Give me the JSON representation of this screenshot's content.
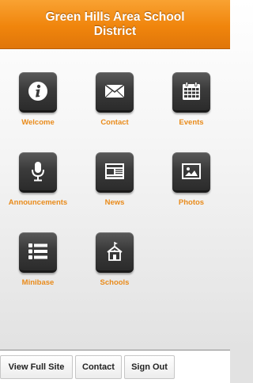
{
  "header": {
    "title": "Green Hills Area School District"
  },
  "tiles": [
    {
      "label": "Welcome",
      "icon": "info-icon"
    },
    {
      "label": "Contact",
      "icon": "envelope-icon"
    },
    {
      "label": "Events",
      "icon": "calendar-icon"
    },
    {
      "label": "Announcements",
      "icon": "microphone-icon"
    },
    {
      "label": "News",
      "icon": "newspaper-icon"
    },
    {
      "label": "Photos",
      "icon": "photo-icon"
    },
    {
      "label": "Minibase",
      "icon": "list-icon"
    },
    {
      "label": "Schools",
      "icon": "school-building-icon"
    }
  ],
  "footer": {
    "view_full_site": "View Full Site",
    "contact": "Contact",
    "sign_out": "Sign Out"
  },
  "colors": {
    "header_orange": "#f0850c",
    "label_orange": "#e98b1b",
    "tile_dark": "#3b3b3b"
  }
}
